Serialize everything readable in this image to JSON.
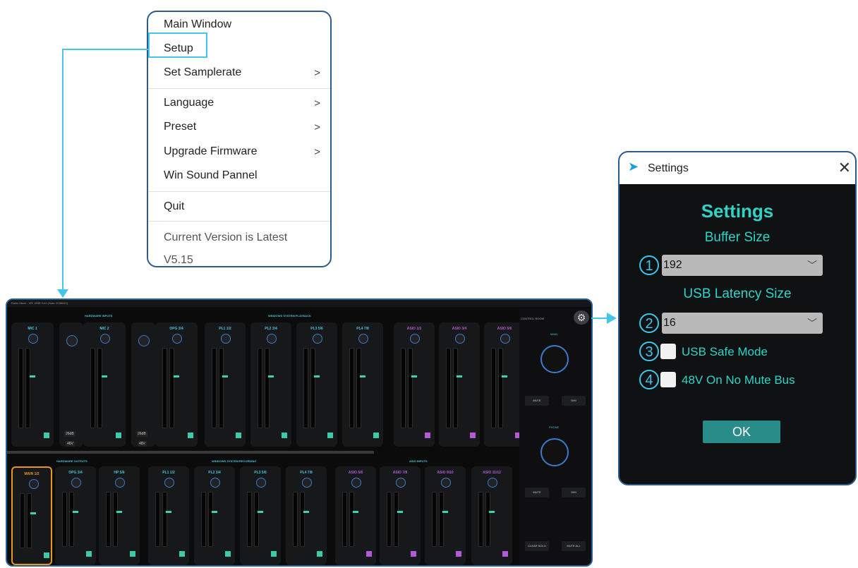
{
  "menu": {
    "items": [
      {
        "label": "Main Window",
        "arrow": ""
      },
      {
        "label": "Setup",
        "arrow": ""
      },
      {
        "label": "Set Samplerate",
        "arrow": ">"
      },
      {
        "label": "Language",
        "arrow": ">"
      },
      {
        "label": "Preset",
        "arrow": ">"
      },
      {
        "label": "Upgrade Firmware",
        "arrow": ">"
      },
      {
        "label": "Win Sound Pannel",
        "arrow": ""
      },
      {
        "label": "Quit",
        "arrow": ""
      }
    ],
    "version_status": "Current Version is Latest",
    "version": "V5.15"
  },
  "mixer": {
    "title": "Rubix Mixer - VR: 2038 9:41 (Host: 2038022)",
    "sections": {
      "hardware_inputs": "HARDWARE INPUTS",
      "system_playback": "WINDOWS SYSTEM PLAYBACK",
      "hardware_outputs": "HARDWARE OUTPUTS",
      "system_recording": "WINDOWS SYSTEM RECORDING",
      "asio_inputs": "ASIO INPUTS"
    },
    "top_strips": [
      "MIC 1",
      "MIC 2",
      "OPG 3/4",
      "PL1 1/2",
      "PL2 3/4",
      "PL3 5/6",
      "PL4 7/8",
      "ASIO 1/2",
      "ASIO 3/4",
      "ASIO 5/6"
    ],
    "bottom_strips": [
      "MAIN 1/2",
      "OPG 3/4",
      "HP 5/6",
      "PL1 1/2",
      "PL2 3/4",
      "PL3 5/6",
      "PL4 7/8",
      "ASIO 5/6",
      "ASIO 7/8",
      "ASIO 9/10",
      "ASIO 11/12"
    ],
    "gain_labels": [
      "26dB",
      "26dB"
    ],
    "phantom_labels": [
      "48V",
      "48V"
    ],
    "side": {
      "control_room": "CONTROL ROOM",
      "main": "MAIN",
      "phone": "PHONE",
      "mute": "MUTE",
      "dim": "DIM",
      "clear_solo": "CLEAR SOLO",
      "mute_all": "MUTE ALL"
    }
  },
  "settings_dialog": {
    "window_title": "Settings",
    "heading": "Settings",
    "buffer_size_label": "Buffer Size",
    "buffer_size_value": "192",
    "usb_latency_label": "USB Latency Size",
    "usb_latency_value": "16",
    "usb_safe_mode_label": "USB Safe Mode",
    "usb_safe_mode_checked": false,
    "mute_bus_label": "48V On No Mute Bus",
    "mute_bus_checked": false,
    "ok_label": "OK",
    "callouts": [
      "1",
      "2",
      "3",
      "4"
    ]
  },
  "colors": {
    "accent_teal": "#2fd4c9",
    "callout_blue": "#41c4ea",
    "magenta": "#b35ad8",
    "frame_blue": "#2c5c8c"
  }
}
